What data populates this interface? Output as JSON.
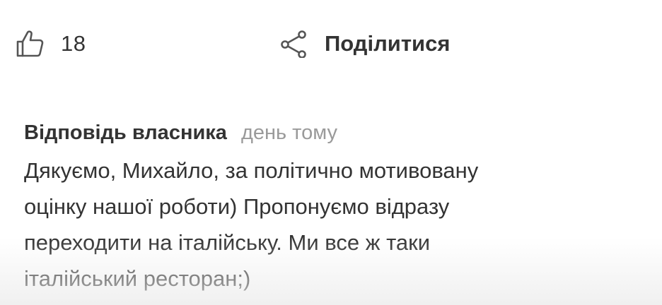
{
  "actions": {
    "like": {
      "icon": "thumbs-up-icon",
      "count": "18"
    },
    "share": {
      "icon": "share-icon",
      "label": "Поділитися"
    }
  },
  "owner_reply": {
    "title": "Відповідь власника",
    "time": "день тому",
    "text": "Дякуємо, Михайло, за політично мотивовану\nоцінку нашої роботи) Пропонуємо відразу\nпереходити на італійську. Ми все ж таки\nіталійський ресторан;)"
  },
  "colors": {
    "text": "#333333",
    "muted": "#9a9a9a",
    "icon": "#555555",
    "background": "#ffffff"
  }
}
